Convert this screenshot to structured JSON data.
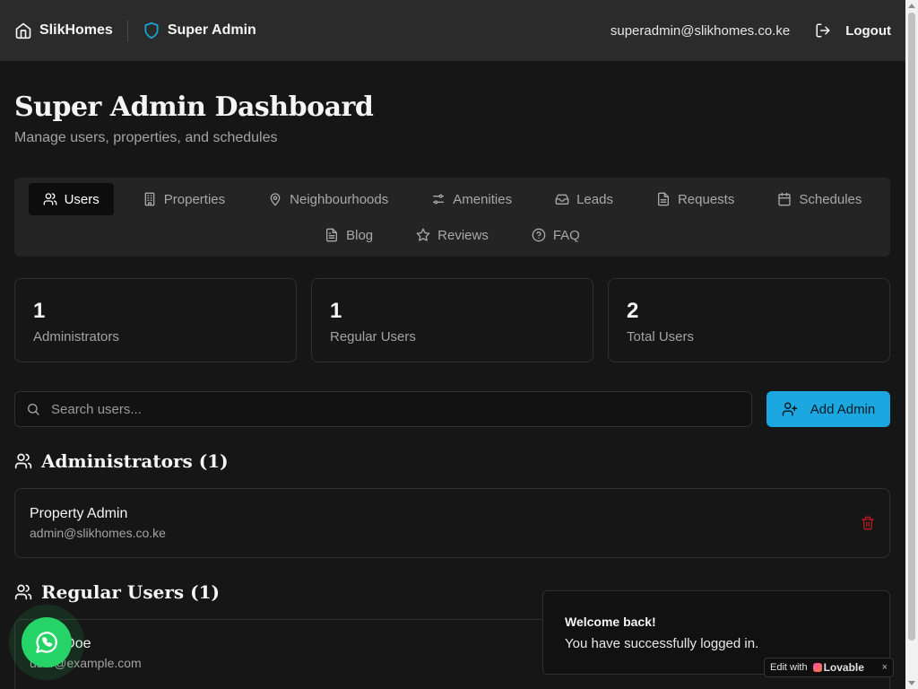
{
  "header": {
    "brand": "SlikHomes",
    "role": "Super Admin",
    "email": "superadmin@slikhomes.co.ke",
    "logout_label": "Logout"
  },
  "page": {
    "title": "Super Admin Dashboard",
    "subtitle": "Manage users, properties, and schedules"
  },
  "tabs": {
    "row1": [
      {
        "label": "Users",
        "icon": "users-icon",
        "active": true
      },
      {
        "label": "Properties",
        "icon": "building-icon"
      },
      {
        "label": "Neighbourhoods",
        "icon": "map-pin-icon"
      },
      {
        "label": "Amenities",
        "icon": "sliders-icon"
      },
      {
        "label": "Leads",
        "icon": "inbox-icon"
      },
      {
        "label": "Requests",
        "icon": "file-text-icon"
      },
      {
        "label": "Schedules",
        "icon": "calendar-icon"
      }
    ],
    "row2": [
      {
        "label": "Blog",
        "icon": "file-icon"
      },
      {
        "label": "Reviews",
        "icon": "star-icon"
      },
      {
        "label": "FAQ",
        "icon": "help-circle-icon"
      }
    ]
  },
  "stats": [
    {
      "value": "1",
      "label": "Administrators"
    },
    {
      "value": "1",
      "label": "Regular Users"
    },
    {
      "value": "2",
      "label": "Total Users"
    }
  ],
  "search": {
    "placeholder": "Search users..."
  },
  "add_admin_label": "Add Admin",
  "administrators": {
    "title": "Administrators (1)",
    "items": [
      {
        "name": "Property Admin",
        "email": "admin@slikhomes.co.ke"
      }
    ]
  },
  "regular_users": {
    "title": "Regular Users (1)",
    "items": [
      {
        "name": "John Doe",
        "email": "user@example.com"
      }
    ]
  },
  "toast": {
    "title": "Welcome back!",
    "message": "You have successfully logged in."
  },
  "lovable_badge": {
    "prefix": "Edit with",
    "brand": "Lovable",
    "close": "×"
  },
  "colors": {
    "accent": "#1ba7df",
    "background": "#161616",
    "danger": "#b91c1c",
    "whatsapp": "#25d366"
  }
}
